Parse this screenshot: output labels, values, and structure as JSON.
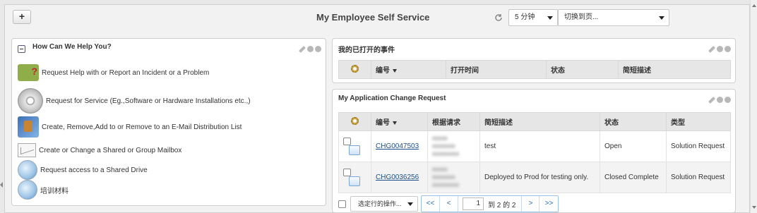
{
  "toolbar": {
    "add_label": "+",
    "page_title": "My Employee Self Service",
    "interval_value": "5 分钟",
    "switch_page_value": "切换到页..."
  },
  "help_panel": {
    "title": "How Can We Help You?",
    "items": [
      {
        "label": "Request Help with or Report an Incident or a Problem",
        "icon": "incident-chat-icon"
      },
      {
        "label": "Request for Service (Eg.,Software or Hardware Installations etc.,)",
        "icon": "cd-disc-icon"
      },
      {
        "label": "Create, Remove,Add to or Remove to an E-Mail Distribution List",
        "icon": "address-book-icon"
      },
      {
        "label": "Create or Change a Shared or Group Mailbox",
        "icon": "envelope-icon"
      },
      {
        "label": "Request access to a Shared Drive",
        "icon": "globe-icon"
      },
      {
        "label": "培训材料",
        "icon": "globe-icon"
      }
    ]
  },
  "opened_events": {
    "title": "我的已打开的事件",
    "columns": [
      "编号",
      "打开时间",
      "状态",
      "简短描述"
    ]
  },
  "change_requests": {
    "title": "My Application Change Request",
    "columns": [
      "编号",
      "根据请求",
      "简短描述",
      "状态",
      "类型"
    ],
    "rows": [
      {
        "number": "CHG0047503",
        "requested_by": "blurred",
        "short_description": "test",
        "state": "Open",
        "type": "Solution Request"
      },
      {
        "number": "CHG0036256",
        "requested_by": "blurred",
        "short_description": "Deployed to Prod for testing only.",
        "state": "Closed Complete",
        "type": "Solution Request"
      }
    ],
    "bulk_action": "选定行的操作...",
    "pager": {
      "first": "<<",
      "prev": "<",
      "current_page": "1",
      "of_text": "到 2 的 2",
      "next": ">",
      "last": ">>"
    }
  },
  "colors": {
    "link": "#1d4f8c",
    "pager_accent": "#2c6bb6",
    "header_bg": "#e6e6e6"
  }
}
